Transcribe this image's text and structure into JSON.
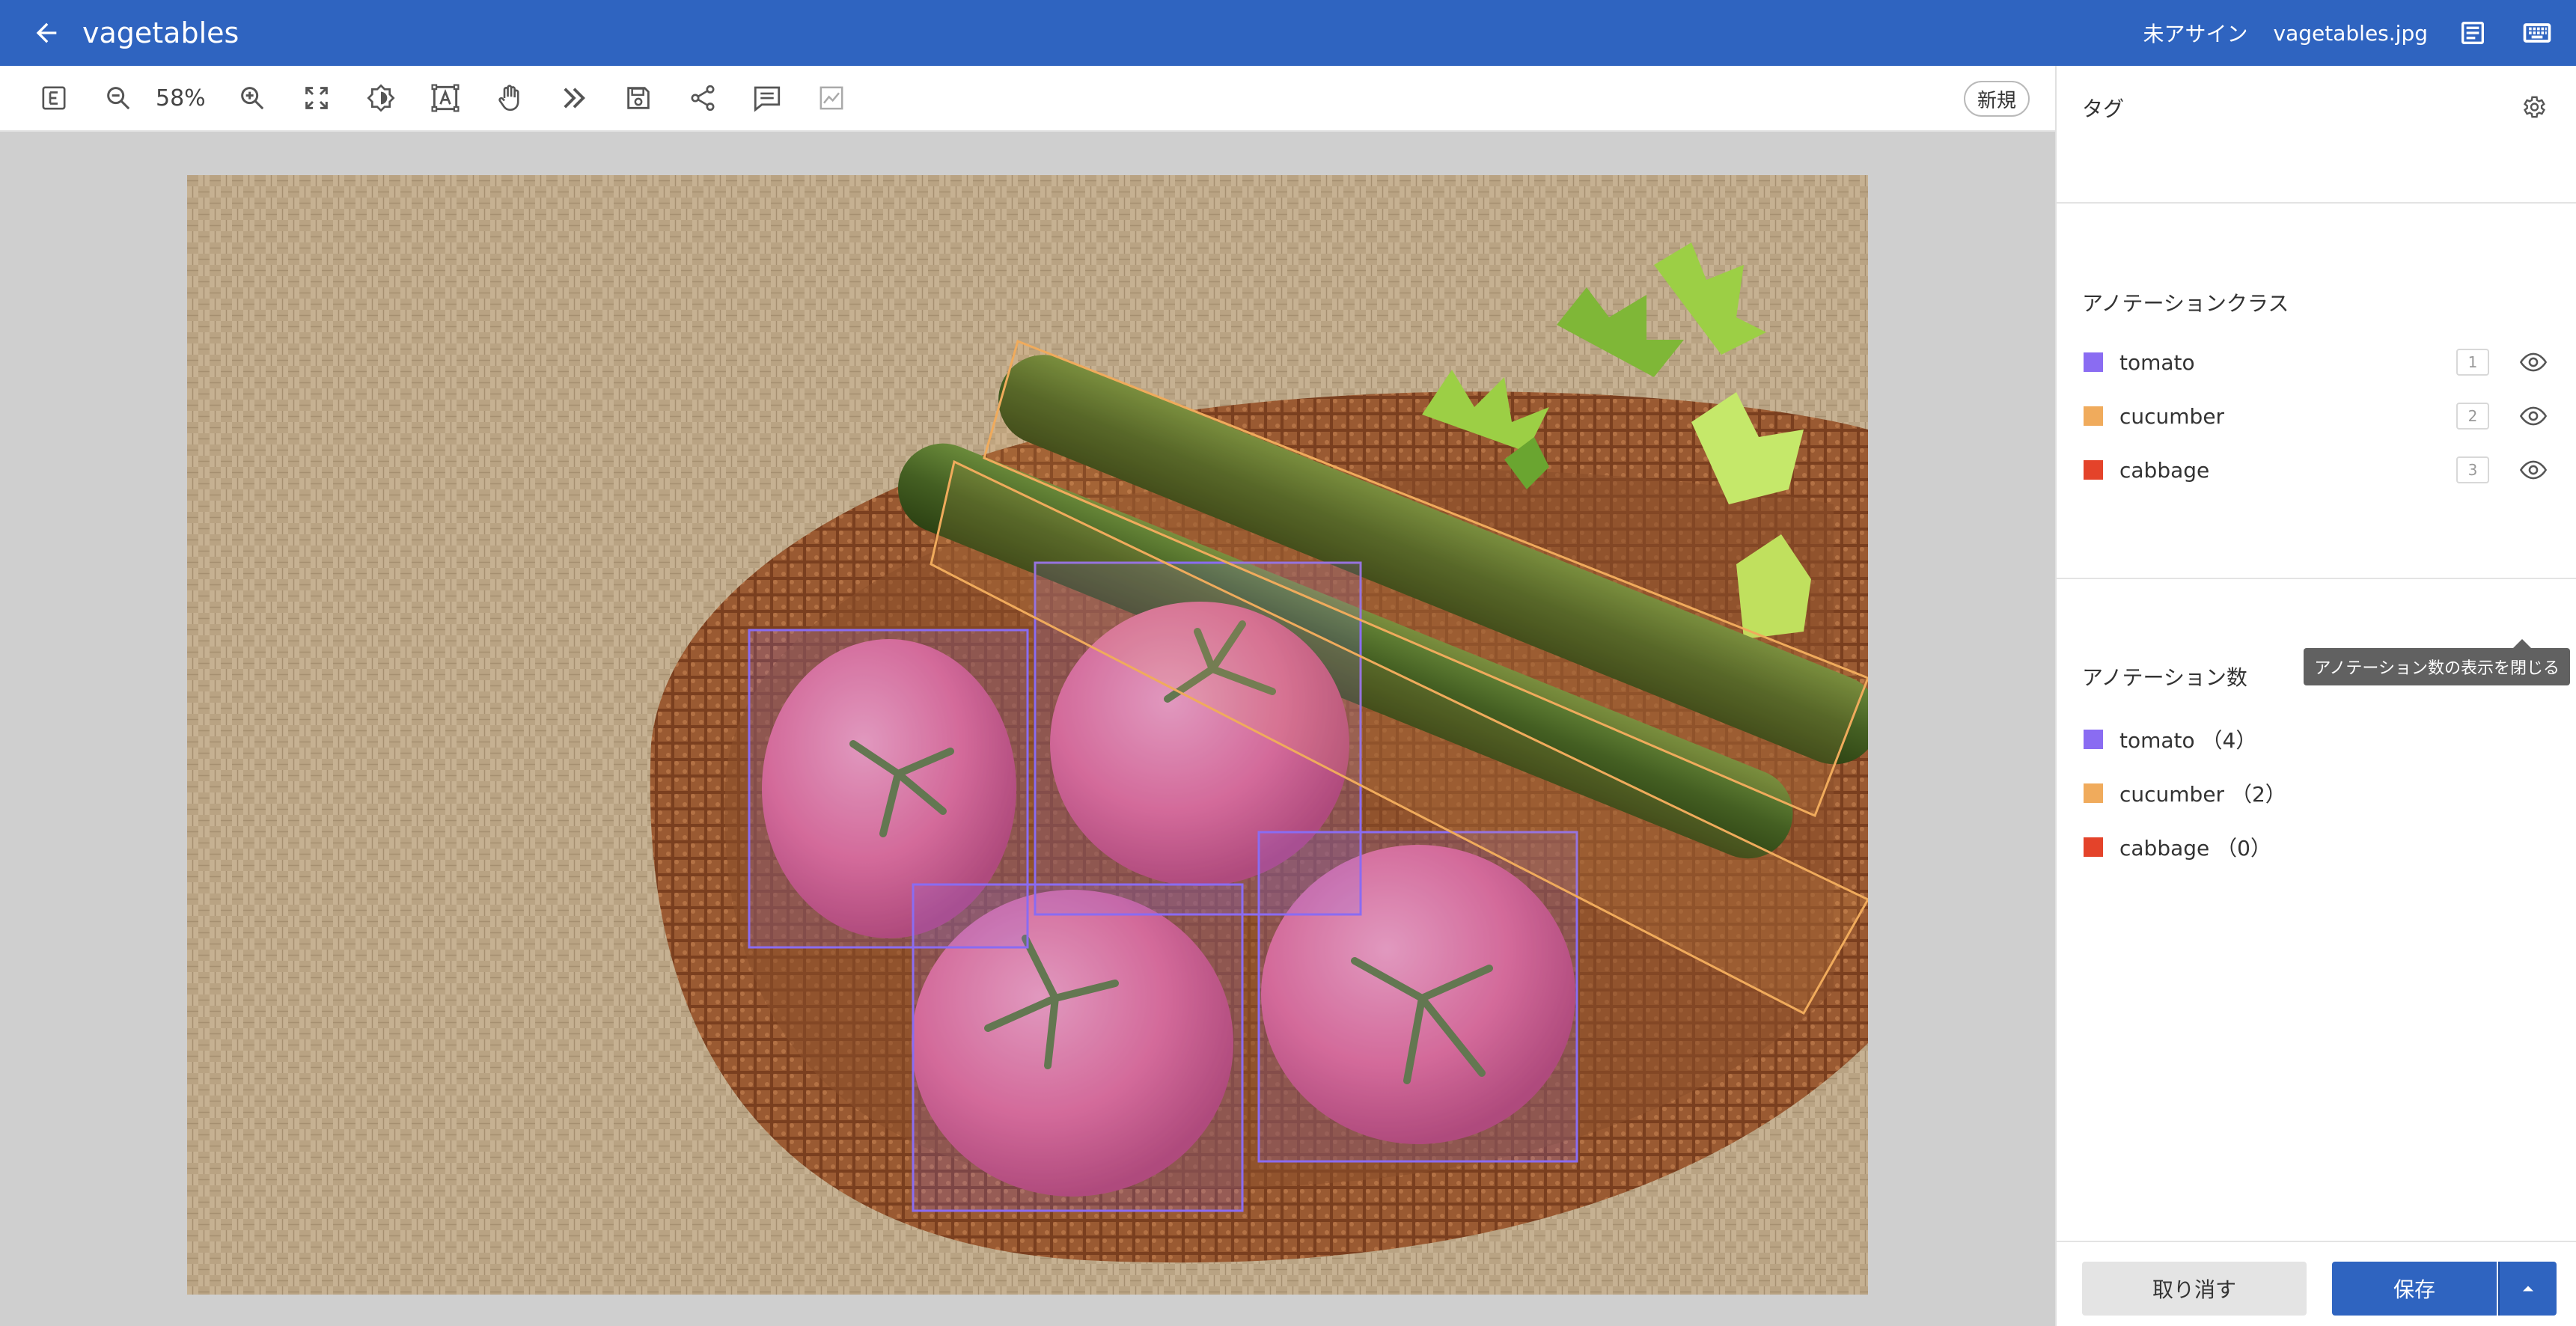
{
  "header": {
    "title": "vagetables",
    "assignee": "未アサイン",
    "filename": "vagetables.jpg",
    "icons": [
      "arrow-back-icon",
      "document-list-icon",
      "keyboard-icon"
    ]
  },
  "toolbar": {
    "zoom": "58%",
    "new_badge": "新規",
    "tools": [
      "e-tool-icon",
      "zoom-out-icon",
      "zoom-in-icon",
      "fit-screen-icon",
      "brightness-icon",
      "text-box-icon",
      "hand-pan-icon",
      "next-icon",
      "save-icon",
      "share-icon",
      "comment-icon",
      "chart-icon"
    ]
  },
  "panel": {
    "tag_title": "タグ",
    "class_title": "アノテーションクラス",
    "classes": [
      {
        "name": "tomato",
        "color": "#8a6cf2",
        "hotkey": "1"
      },
      {
        "name": "cucumber",
        "color": "#f0ab5c",
        "hotkey": "2"
      },
      {
        "name": "cabbage",
        "color": "#e4432a",
        "hotkey": "3"
      }
    ],
    "count_title": "アノテーション数",
    "counts": [
      {
        "label": "tomato （4）",
        "color": "#8a6cf2"
      },
      {
        "label": "cucumber （2）",
        "color": "#f0ab5c"
      },
      {
        "label": "cabbage （0）",
        "color": "#e4432a"
      }
    ],
    "tooltip": "アノテーション数の表示を閉じる"
  },
  "footer": {
    "cancel": "取り消す",
    "save": "保存"
  }
}
